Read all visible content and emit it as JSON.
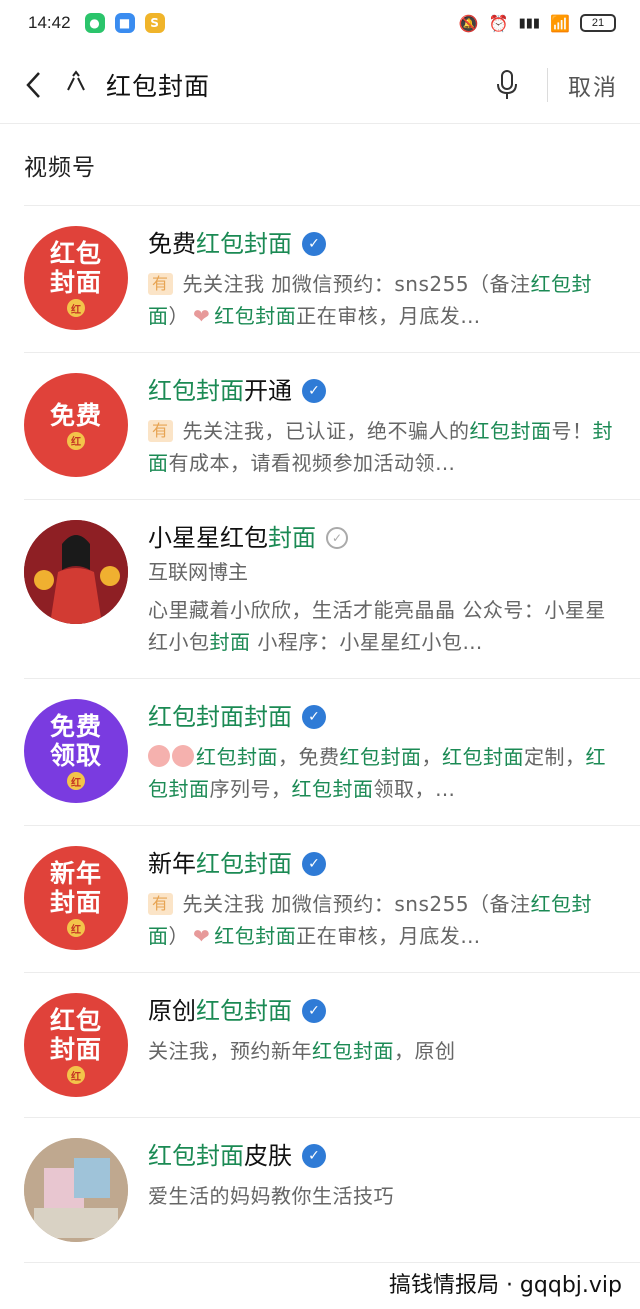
{
  "status": {
    "time": "14:42",
    "battery": "21"
  },
  "search": {
    "query": "红包封面",
    "cancel": "取消"
  },
  "section": "视频号",
  "results": [
    {
      "avatar": {
        "lines": [
          "红包",
          "封面"
        ],
        "bg": "#e0423a"
      },
      "title_pre": "免费",
      "title_hl": "红包封面",
      "title_post": "",
      "verified": "blue",
      "desc_parts": [
        "有",
        "先关注我 加微信预约：sns255（备注",
        "红包封面",
        "）",
        "红包封面",
        "正在审核，月底发…"
      ]
    },
    {
      "avatar": {
        "lines": [
          "免费"
        ],
        "bg": "#e0423a"
      },
      "title_pre": "",
      "title_hl": "红包封面",
      "title_post": "开通",
      "verified": "blue",
      "desc_parts": [
        "有",
        "先关注我，已认证，绝不骗人的",
        "红包封面",
        "号！",
        "封面",
        "有成本，请看视频参加活动领…"
      ]
    },
    {
      "avatar": {
        "lines": [],
        "bg": "#8e1f24"
      },
      "title_pre": "小星星红包",
      "title_hl": "封面",
      "title_post": "",
      "verified": "gray",
      "sub": "互联网博主",
      "desc_parts": [
        "心里藏着小欣欣，生活才能亮晶晶 公众号：小星星红小包",
        "封面",
        " 小程序：小星星红小包…"
      ]
    },
    {
      "avatar": {
        "lines": [
          "免费",
          "领取"
        ],
        "bg": "#7a3be0"
      },
      "title_pre": "",
      "title_hl": "红包封面封面",
      "title_post": "",
      "verified": "blue",
      "desc_parts": [
        "红包封面",
        "，免费",
        "红包封面",
        "，",
        "红包封面",
        "定制，",
        "红包封面",
        "序列号，",
        "红包封面",
        "领取，…"
      ]
    },
    {
      "avatar": {
        "lines": [
          "新年",
          "封面"
        ],
        "bg": "#e0423a"
      },
      "title_pre": "新年",
      "title_hl": "红包封面",
      "title_post": "",
      "verified": "blue",
      "desc_parts": [
        "有",
        "先关注我 加微信预约：sns255（备注",
        "红包封面",
        "）",
        "红包封面",
        "正在审核，月底发…"
      ]
    },
    {
      "avatar": {
        "lines": [
          "红包",
          "封面"
        ],
        "bg": "#e0423a"
      },
      "title_pre": "原创",
      "title_hl": "红包封面",
      "title_post": "",
      "verified": "blue",
      "desc_parts": [
        "关注我，预约新年",
        "红包封面",
        "，原创"
      ]
    },
    {
      "avatar": {
        "lines": [],
        "bg": "#c9b49a"
      },
      "title_pre": "",
      "title_hl": "红包封面",
      "title_post": "皮肤",
      "verified": "blue",
      "desc_parts": [
        "爱生活的妈妈教你生活技巧"
      ]
    }
  ],
  "watermark": "搞钱情报局 · gqqbj.vip"
}
